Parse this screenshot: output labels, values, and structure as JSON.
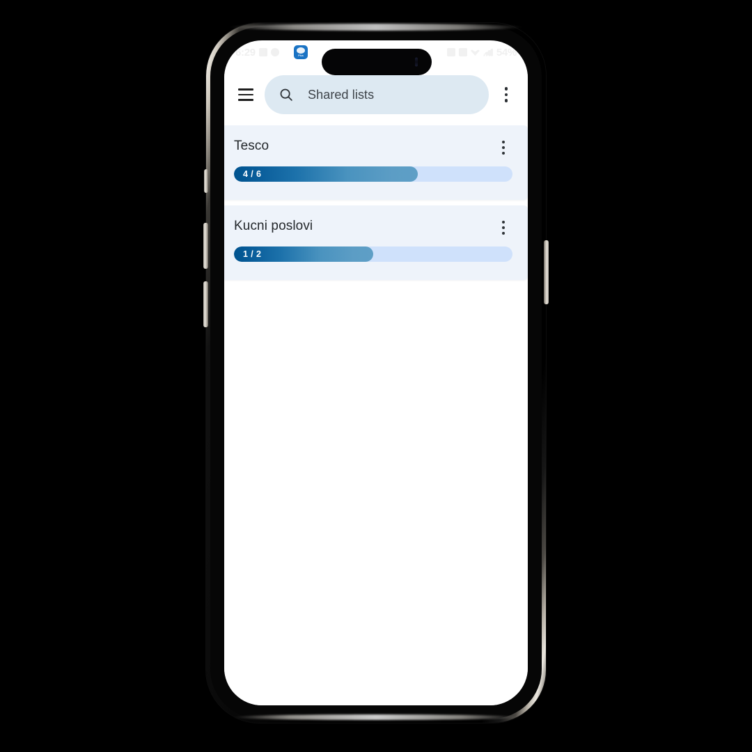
{
  "status_bar": {
    "time": "6:29",
    "battery_percent": "54%",
    "icons": [
      "message-icon",
      "photo-icon",
      "app-badge-icon",
      "chevron-down-icon"
    ],
    "right_icons": [
      "alarm-icon",
      "bluetooth-icon",
      "wifi-icon",
      "signal-icon"
    ],
    "app_icon_label": "Plus"
  },
  "appbar": {
    "menu_icon": "hamburger-menu-icon",
    "search": {
      "icon": "search-icon",
      "value": "Shared lists",
      "placeholder": "Shared lists"
    },
    "overflow_icon": "more-vert-icon"
  },
  "lists": [
    {
      "title": "Tesco",
      "progress_label": "4 / 6",
      "completed": 4,
      "total": 6,
      "percent": 66,
      "menu_icon": "more-vert-icon"
    },
    {
      "title": "Kucni poslovi",
      "progress_label": "1 / 2",
      "completed": 1,
      "total": 2,
      "percent": 50,
      "menu_icon": "more-vert-icon"
    }
  ],
  "colors": {
    "search_bg": "#dde9f2",
    "card_bg": "#eef3fa",
    "progress_track": "#cfe1fb",
    "progress_start": "#00538f",
    "progress_end": "#5e9fc6",
    "app_icon": "#1a73c4"
  }
}
